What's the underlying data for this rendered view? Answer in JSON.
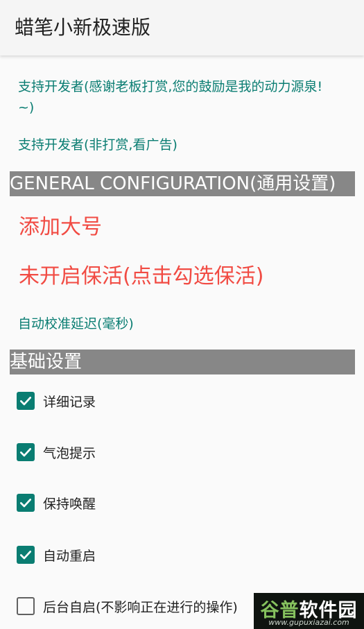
{
  "appbar": {
    "title": "蜡笔小新极速版"
  },
  "support": {
    "donate_line1": "支持开发者(感谢老板打赏,您的鼓励是我的动力源泉!",
    "donate_line2": "~)",
    "ads": "支持开发者(非打赏,看广告)"
  },
  "general": {
    "header": "GENERAL  CONFIGURATION(通用设置)",
    "add_account": "添加大号",
    "keep_alive": "未开启保活(点击勾选保活)",
    "calibration_delay": "自动校准延迟(毫秒)"
  },
  "basic": {
    "header": "基础设置",
    "items": [
      {
        "label": "详细记录",
        "checked": true
      },
      {
        "label": "气泡提示",
        "checked": true
      },
      {
        "label": "保持唤醒",
        "checked": true
      },
      {
        "label": "自动重启",
        "checked": true
      },
      {
        "label": "后台自启(不影响正在进行的操作)",
        "checked": false
      }
    ]
  },
  "watermark": {
    "brand_green": "谷普",
    "brand_white": "软件园",
    "url": "www.gupuxiazai.com"
  },
  "colors": {
    "accent": "#0a7d72",
    "warning_red": "#f14b43",
    "section_gray": "#878787"
  }
}
